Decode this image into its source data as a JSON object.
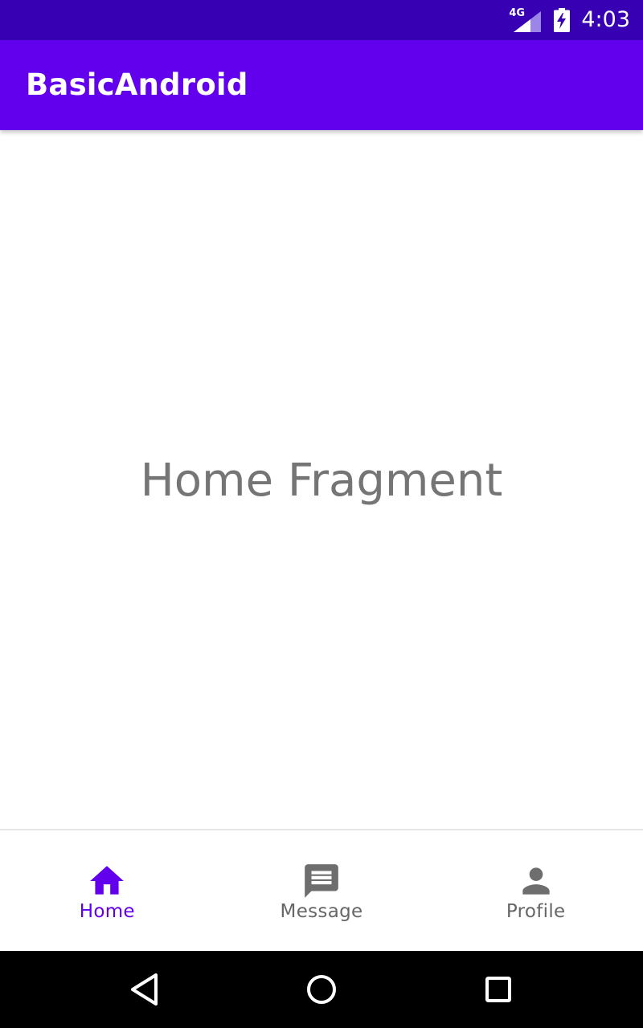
{
  "status_bar": {
    "network_type": "4G",
    "time": "4:03",
    "background_color": "#3700b3",
    "icons": [
      "signal-icon",
      "battery-charging-icon"
    ]
  },
  "app_bar": {
    "title": "BasicAndroid",
    "background_color": "#6200ee"
  },
  "content": {
    "label": "Home Fragment"
  },
  "bottom_nav": {
    "active_color": "#6200ee",
    "inactive_color": "#666666",
    "items": [
      {
        "label": "Home",
        "icon": "home-icon",
        "active": true
      },
      {
        "label": "Message",
        "icon": "message-icon",
        "active": false
      },
      {
        "label": "Profile",
        "icon": "person-icon",
        "active": false
      }
    ]
  },
  "system_nav": {
    "buttons": [
      "back-icon",
      "home-circle-icon",
      "recents-icon"
    ]
  }
}
